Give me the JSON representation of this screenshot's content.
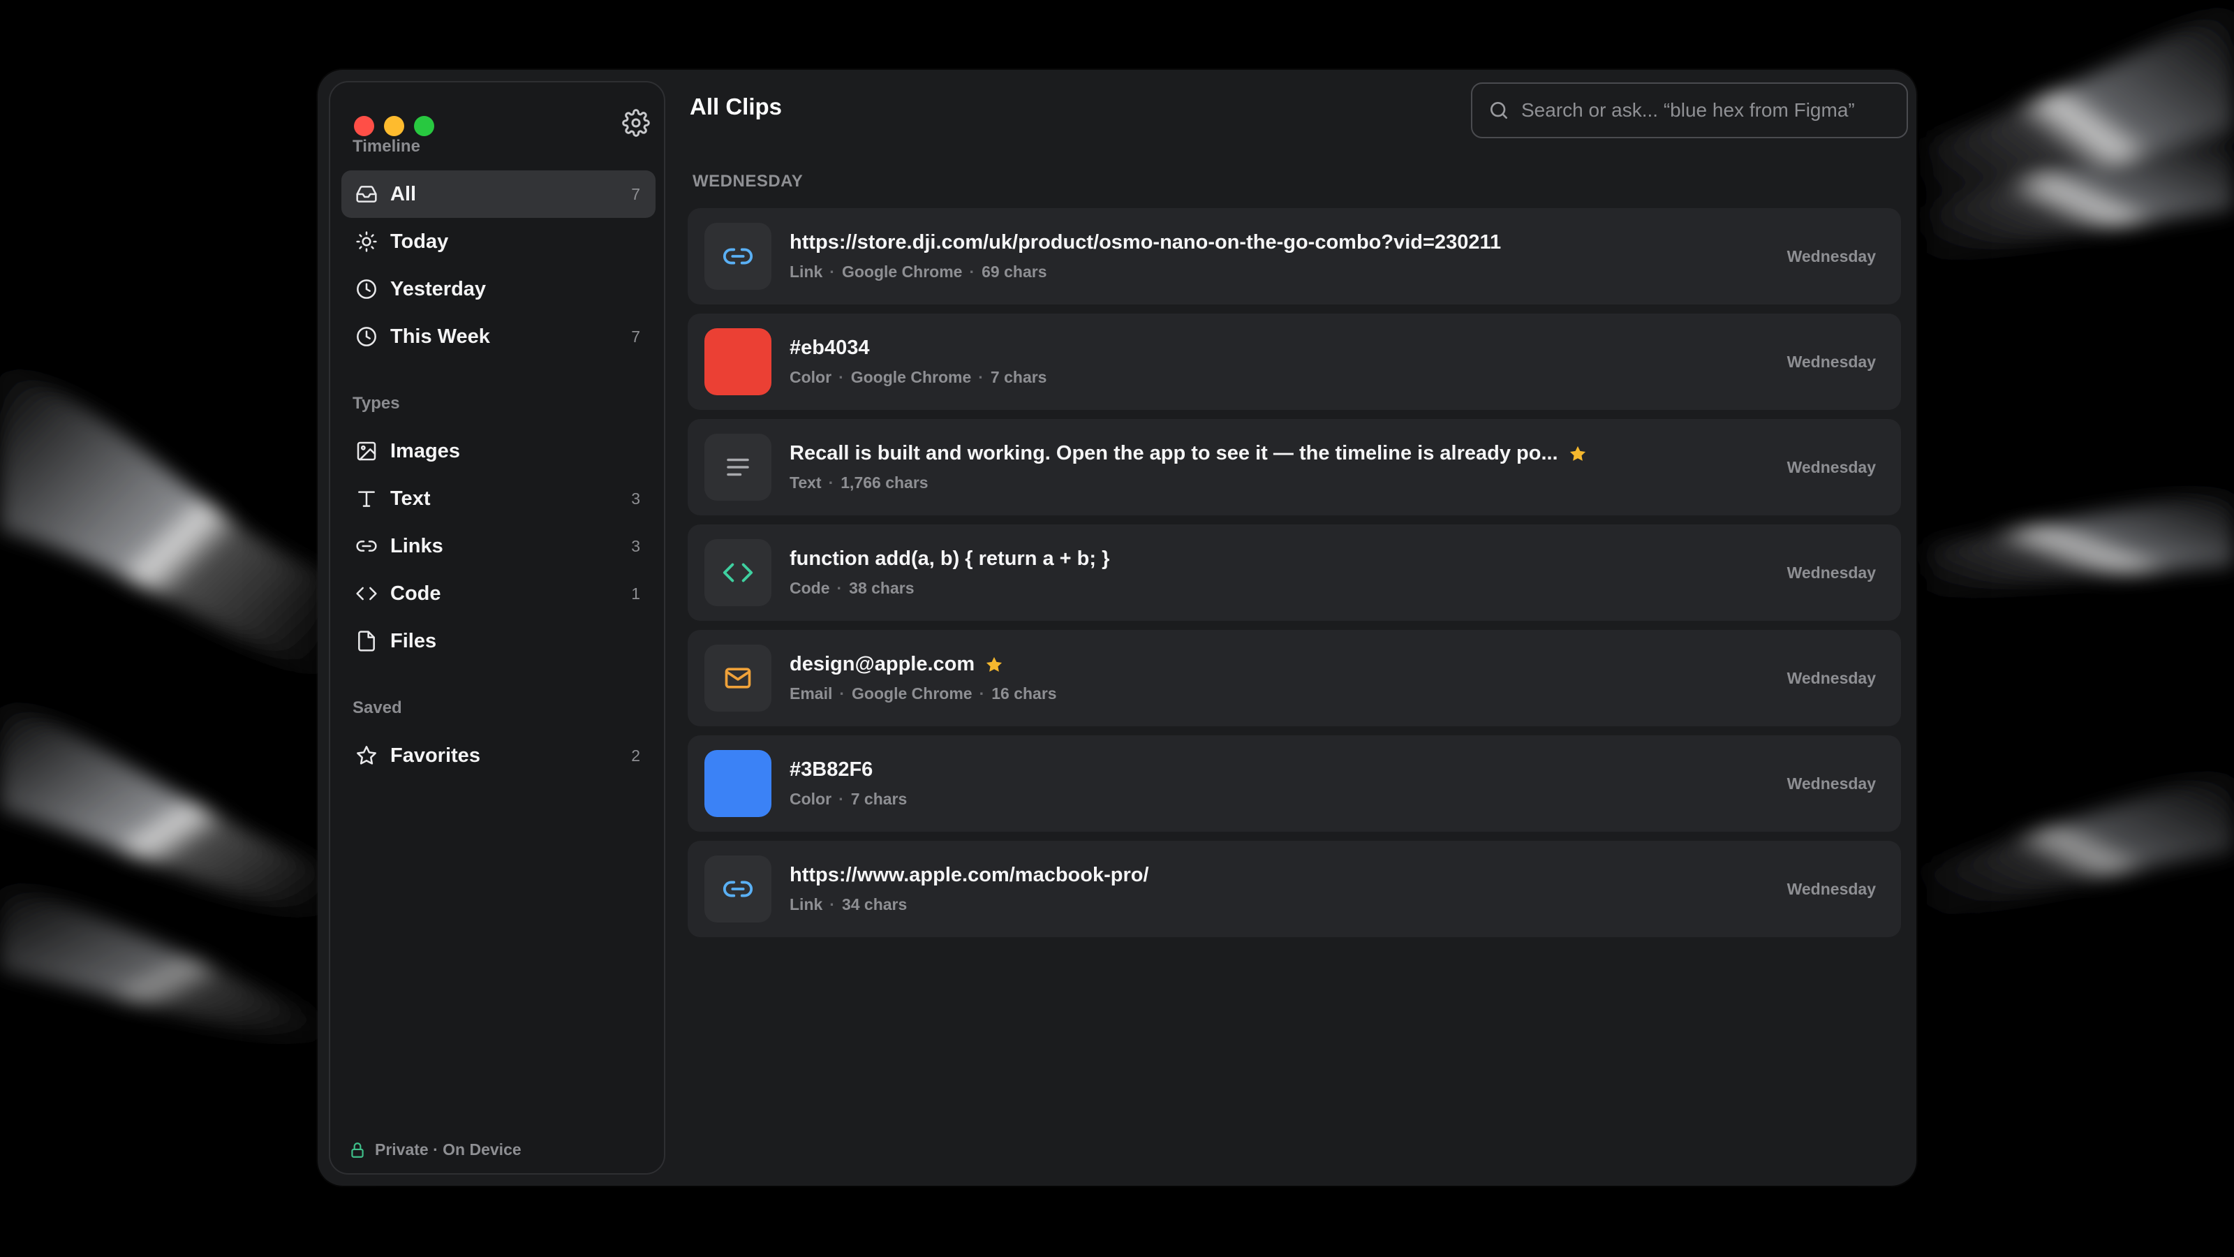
{
  "window": {
    "title": "All Clips"
  },
  "sidebar": {
    "timeline_label": "Timeline",
    "timeline": [
      {
        "label": "All",
        "count": "7",
        "icon": "inbox-icon",
        "active": true
      },
      {
        "label": "Today",
        "count": "",
        "icon": "sun-icon"
      },
      {
        "label": "Yesterday",
        "count": "",
        "icon": "clock-icon"
      },
      {
        "label": "This Week",
        "count": "7",
        "icon": "clock-icon"
      }
    ],
    "types_label": "Types",
    "types": [
      {
        "label": "Images",
        "count": "",
        "icon": "image-icon"
      },
      {
        "label": "Text",
        "count": "3",
        "icon": "text-icon"
      },
      {
        "label": "Links",
        "count": "3",
        "icon": "link-icon"
      },
      {
        "label": "Code",
        "count": "1",
        "icon": "code-icon"
      },
      {
        "label": "Files",
        "count": "",
        "icon": "file-icon"
      }
    ],
    "saved_label": "Saved",
    "saved": [
      {
        "label": "Favorites",
        "count": "2",
        "icon": "star-outline-icon"
      }
    ],
    "footer": "Private · On Device"
  },
  "search": {
    "placeholder": "Search or ask... “blue hex from Figma”"
  },
  "list": {
    "day_label": "WEDNESDAY",
    "clips": [
      {
        "title": "https://store.dji.com/uk/product/osmo-nano-on-the-go-combo?vid=230211",
        "type": "Link",
        "source": "Google Chrome",
        "size": "69 chars",
        "time": "Wednesday",
        "icon": "link-icon",
        "favorite": false
      },
      {
        "title": "#eb4034",
        "type": "Color",
        "source": "Google Chrome",
        "size": "7 chars",
        "time": "Wednesday",
        "swatch": "#eb4034",
        "favorite": false
      },
      {
        "title": "Recall is built and working. Open the app to see it — the timeline is already po...",
        "type": "Text",
        "source": "",
        "size": "1,766 chars",
        "time": "Wednesday",
        "icon": "text-lines-icon",
        "favorite": true
      },
      {
        "title": "function add(a, b) { return a + b; }",
        "type": "Code",
        "source": "",
        "size": "38 chars",
        "time": "Wednesday",
        "icon": "code-icon",
        "favorite": false
      },
      {
        "title": "design@apple.com",
        "type": "Email",
        "source": "Google Chrome",
        "size": "16 chars",
        "time": "Wednesday",
        "icon": "mail-icon",
        "favorite": true
      },
      {
        "title": "#3B82F6",
        "type": "Color",
        "source": "",
        "size": "7 chars",
        "time": "Wednesday",
        "swatch": "#3B82F6",
        "favorite": false
      },
      {
        "title": "https://www.apple.com/macbook-pro/",
        "type": "Link",
        "source": "",
        "size": "34 chars",
        "time": "Wednesday",
        "icon": "link-icon",
        "favorite": false
      }
    ]
  },
  "colors": {
    "link": "#5ab0f5",
    "code": "#3fd0a0",
    "mail": "#f0a23a",
    "star": "#f5b82e",
    "lock": "#3fc08a"
  }
}
